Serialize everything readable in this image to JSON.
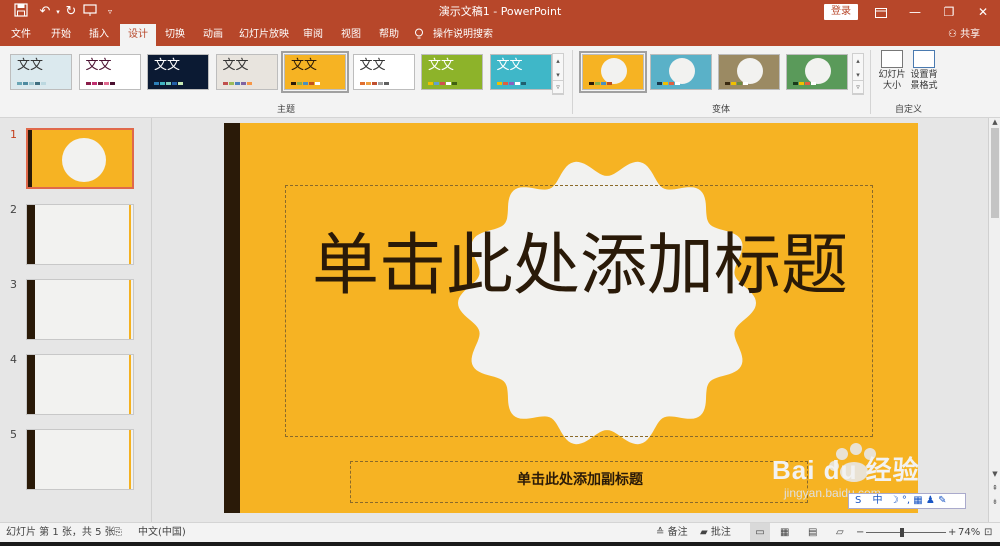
{
  "titlebar": {
    "document": "演示文稿1",
    "separator": " - ",
    "app": "PowerPoint",
    "login": "登录"
  },
  "tabs": [
    {
      "label": "文件",
      "active": false
    },
    {
      "label": "开始",
      "active": false
    },
    {
      "label": "插入",
      "active": false
    },
    {
      "label": "设计",
      "active": true
    },
    {
      "label": "切换",
      "active": false
    },
    {
      "label": "动画",
      "active": false
    },
    {
      "label": "幻灯片放映",
      "active": false
    },
    {
      "label": "审阅",
      "active": false
    },
    {
      "label": "视图",
      "active": false
    },
    {
      "label": "帮助",
      "active": false
    },
    {
      "label": "操作说明搜索",
      "active": false
    }
  ],
  "share": "共享",
  "ribbon": {
    "themes_label": "主题",
    "variants_label": "变体",
    "custom_label": "自定义",
    "themes": [
      {
        "text": "文文",
        "bg": "#dbe9ee",
        "fg": "#333333",
        "colors": [
          "#6aa6b6",
          "#4e8aa0",
          "#9fc6d0",
          "#3f6f80",
          "#bcd8e0"
        ]
      },
      {
        "text": "文文",
        "bg": "#ffffff",
        "fg": "#4a1030",
        "colors": [
          "#8a1e4a",
          "#c03070",
          "#6a1a3a",
          "#e06a90",
          "#4a1030"
        ]
      },
      {
        "text": "文文",
        "bg": "#0b1a33",
        "fg": "#ffffff",
        "colors": [
          "#2c7fb8",
          "#41b6c4",
          "#7fcdbb",
          "#225ea8",
          "#c7e9b4"
        ]
      },
      {
        "text": "文文",
        "bg": "#e8e4de",
        "fg": "#333333",
        "colors": [
          "#c0504d",
          "#9bbb59",
          "#4f81bd",
          "#8064a2",
          "#f79646"
        ]
      },
      {
        "text": "文文",
        "bg": "#f6b323",
        "fg": "#2a1a08",
        "colors": [
          "#2a1a08",
          "#8ab04a",
          "#4a90c0",
          "#c05020",
          "#ffffff"
        ]
      },
      {
        "text": "文文",
        "bg": "#ffffff",
        "fg": "#333333",
        "colors": [
          "#e07030",
          "#f0a040",
          "#c05030",
          "#a0a0a0",
          "#606060"
        ]
      },
      {
        "text": "文文",
        "bg": "#8db32a",
        "fg": "#ffffff",
        "colors": [
          "#f0c000",
          "#60a0d0",
          "#d05050",
          "#ffffff",
          "#406010"
        ]
      },
      {
        "text": "文文",
        "bg": "#3fb7c8",
        "fg": "#ffffff",
        "colors": [
          "#f0c000",
          "#e06040",
          "#8a60c0",
          "#ffffff",
          "#206070"
        ]
      }
    ],
    "variants": [
      {
        "bg": "#f6b323",
        "colors": [
          "#2a1a08",
          "#8ab04a",
          "#4a90c0",
          "#c05020"
        ]
      },
      {
        "bg": "#5ab1c8",
        "colors": [
          "#1a3a50",
          "#f0c000",
          "#e06040",
          "#ffffff"
        ]
      },
      {
        "bg": "#9b8a63",
        "colors": [
          "#3a2a10",
          "#f0c000",
          "#6a8a40",
          "#ffffff"
        ]
      },
      {
        "bg": "#5a9a5a",
        "colors": [
          "#1a3a1a",
          "#f0c000",
          "#e06040",
          "#ffffff"
        ]
      }
    ],
    "slide_size": "幻灯片\n大小",
    "bg_format": "设置背\n景格式"
  },
  "slides": [
    {
      "number": "1",
      "active": true
    },
    {
      "number": "2",
      "active": false
    },
    {
      "number": "3",
      "active": false
    },
    {
      "number": "4",
      "active": false
    },
    {
      "number": "5",
      "active": false
    }
  ],
  "slide": {
    "title": "单击此处添加标题",
    "subtitle": "单击此处添加副标题",
    "bg_color": "#f6b323",
    "spine_color": "#2a1a08",
    "badge_color": "#f2f2f0"
  },
  "status": {
    "slide_info": "幻灯片 第 1 张，共 5 张",
    "language": "中文(中国)",
    "notes": "备注",
    "comments": "批注",
    "zoom": "74%",
    "zoom_level": 0.45
  },
  "watermark": {
    "brand": "Bai du 经验",
    "url": "jingyan.baidu.com"
  },
  "ime": {
    "label": "中"
  }
}
